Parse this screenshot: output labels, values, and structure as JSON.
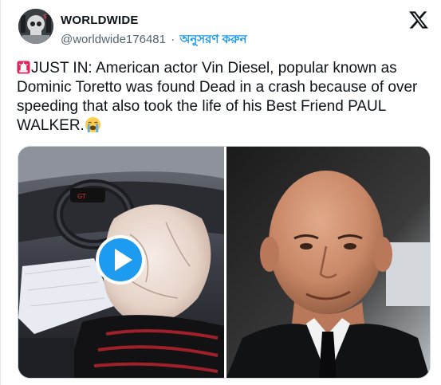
{
  "account": {
    "name": "WORLDWIDE",
    "handle": "@worldwide176481",
    "separator": "·",
    "follow_label": "অনুসরণ করুন",
    "avatar_icon": "skull-avatar-icon"
  },
  "header": {
    "logo_icon": "x-logo-icon"
  },
  "tweet": {
    "emoji_lead": "siren-emoji-icon",
    "text_main": "JUST IN: American actor Vin Diesel, popular known as Dominic Toretto was found Dead in a crash because of over speeding that also took the life of his Best Friend PAUL WALKER.",
    "emoji_trail": "loudly-crying-face-emoji-icon"
  },
  "media": {
    "left": {
      "kind": "video",
      "description_icon": "play-icon"
    },
    "right": {
      "kind": "photo"
    }
  },
  "colors": {
    "link": "#1d9bf0",
    "secondary_text": "#536471",
    "primary_text": "#0f1419",
    "play_button": "#1d9bf0"
  }
}
